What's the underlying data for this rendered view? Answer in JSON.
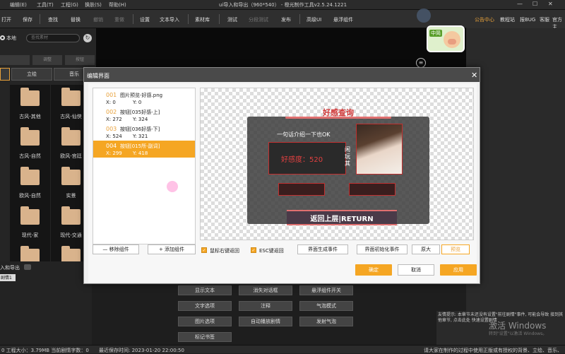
{
  "window": {
    "title": "ui导入和导出（960*540） - 橙光制作工具v2.5.24.1221",
    "min": "—",
    "max": "☐",
    "close": "✕"
  },
  "menu": {
    "file": "编辑(E)",
    "tools": "工具(T)",
    "project": "工程(G)",
    "skin": "换肤(S)",
    "help": "帮助(H)"
  },
  "toolbar": {
    "open": "打开",
    "save": "保存",
    "find": "查找",
    "replace": "替换",
    "undo": "撤销",
    "redo": "重做",
    "settings": "设置",
    "text_import": "文本导入",
    "library": "素材库",
    "test": "测试",
    "branch_test": "分段测试",
    "publish": "发布",
    "advanced_ui": "高级UI",
    "float_widget": "悬浮组件"
  },
  "rightbar": {
    "notice_center": "公告中心",
    "tutorial": "教程站",
    "report_bug": "报BUG",
    "service": "客服",
    "mine": "官方主"
  },
  "left": {
    "local_label": "本地",
    "search_placeholder": "查找素材",
    "subtabs": [
      "",
      "调整",
      "按钮"
    ],
    "cattabs": [
      "",
      "立绘",
      "音乐"
    ],
    "tiles": [
      "古风-其他",
      "古风-仙侠",
      "古风-自然",
      "欧风-宫廷",
      "欧风-自然",
      "实景",
      "现代-家",
      "现代-交通",
      "",
      ""
    ]
  },
  "badge": {
    "text": "中简"
  },
  "dialog": {
    "title": "编辑界面",
    "close": "✕",
    "items": [
      {
        "num": "001",
        "name": "图片预览-好感.png",
        "x": "X: 0",
        "y": "Y: 0"
      },
      {
        "num": "002",
        "name": "按钮[035好感-上]",
        "x": "X: 272",
        "y": "Y: 324"
      },
      {
        "num": "003",
        "name": "按钮[036好感-下]",
        "x": "X: 524",
        "y": "Y: 321"
      },
      {
        "num": "004",
        "name": "按钮[015所-副词]",
        "x": "X: 299",
        "y": "Y: 418"
      }
    ],
    "preview": {
      "title": "好感查询",
      "sentence": "一句话介绍一下也OK",
      "favor": "好感度：520",
      "side": "闲玩其",
      "return": "返回上层|RETURN"
    },
    "remove_btn": "— 移除组件",
    "add_btn": "+ 添加组件",
    "chk_right": "鼠标右键返回",
    "chk_esc": "ESC键返回",
    "gen_event": "界面生成事件",
    "init_event": "界面初始化事件",
    "original": "原大",
    "preview_btn": "预览",
    "ok": "确定",
    "cancel": "取消",
    "apply": "应用"
  },
  "bottom": {
    "tag": "入和导出",
    "item": "剧情1",
    "buttons": [
      "显示文本",
      "消失对话框",
      "悬浮组件开关",
      "文字选项",
      "注释",
      "气泡模式",
      "图片选项",
      "自动播放剧情",
      "发射气泡",
      "标记书签"
    ]
  },
  "status": {
    "left": "0 工程大小：3.79MB  当前剧情字数：0",
    "time": "最近保存时间:    2023-01-20 22:00:50",
    "right": "请大家在制作的过程中使用正版或有授权的背景、立绘、音乐、"
  },
  "notice": {
    "text": "友情提示: 本章节未还没有设置\"前往剧情\"事件, 可能会导致\n接到其他章节, 点击此处 快速设置剧情",
    "link": "快速设置剧情"
  },
  "watermark": {
    "title": "激活 Windows",
    "sub": "转到\"设置\"以激活 Windows。"
  }
}
